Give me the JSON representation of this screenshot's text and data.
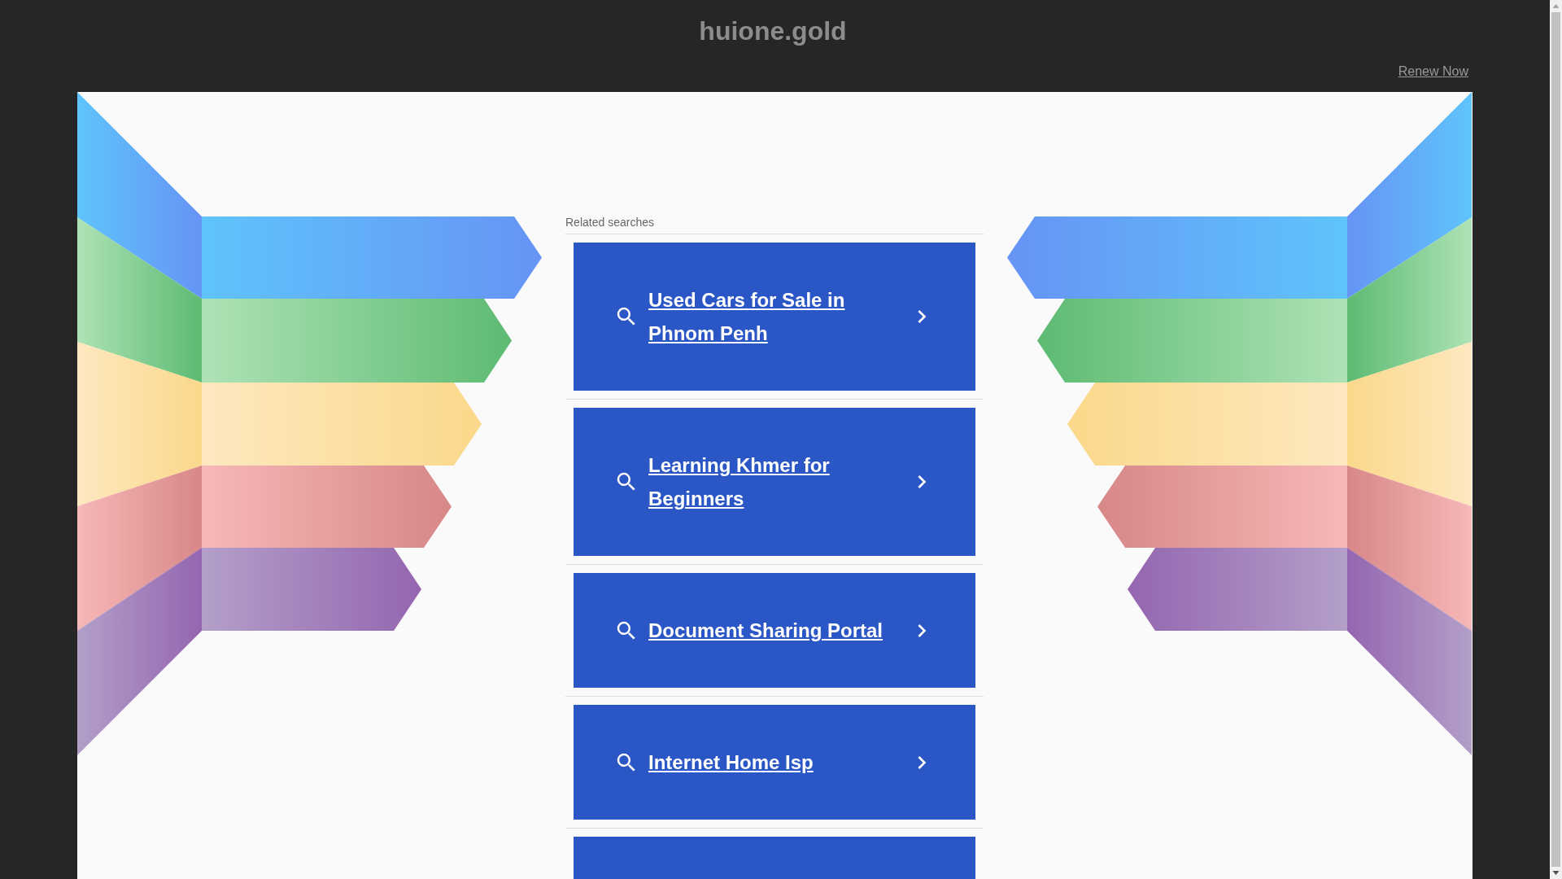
{
  "header": {
    "title": "huione.gold",
    "renew_link": "Renew Now"
  },
  "related": {
    "heading": "Related searches",
    "items": [
      {
        "text": "Used Cars for Sale in Phnom Penh"
      },
      {
        "text": "Learning Khmer for Beginners"
      },
      {
        "text": "Document Sharing Portal"
      },
      {
        "text": "Internet Home Isp"
      }
    ],
    "cut_off_card": true
  }
}
